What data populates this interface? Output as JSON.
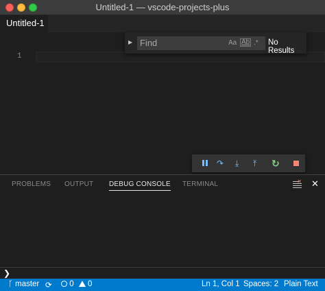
{
  "window": {
    "title": "Untitled-1 — vscode-projects-plus"
  },
  "editor": {
    "tab_label": "Untitled-1",
    "line_number": "1"
  },
  "find": {
    "placeholder": "Find",
    "match_case": "Aa",
    "whole_word": "Ab",
    "regex": ".*",
    "result": "No Results"
  },
  "panel": {
    "tabs": [
      {
        "label": "PROBLEMS"
      },
      {
        "label": "OUTPUT"
      },
      {
        "label": "DEBUG CONSOLE"
      },
      {
        "label": "TERMINAL"
      }
    ],
    "active_tab": "DEBUG CONSOLE",
    "prompt": "❯"
  },
  "statusbar": {
    "branch": "master",
    "errors": "0",
    "warnings": "0",
    "position": "Ln 1, Col 1",
    "spaces": "Spaces: 2",
    "language": "Plain Text"
  },
  "colors": {
    "statusbar_bg": "#007acc",
    "debug_action": "#75beff",
    "restart": "#89d185",
    "stop": "#f48771"
  },
  "icons": [
    "close-window",
    "minimize-window",
    "maximize-window",
    "chevron-right",
    "pause",
    "step-over",
    "step-into",
    "step-out",
    "restart",
    "stop",
    "clear-console",
    "close",
    "git-branch",
    "sync",
    "error",
    "warning"
  ]
}
